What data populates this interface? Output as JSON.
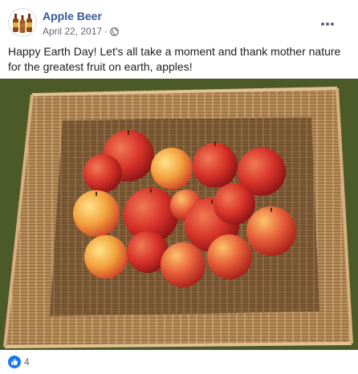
{
  "post": {
    "page_name": "Apple Beer",
    "date": "April 22, 2017",
    "separator": "·",
    "privacy_icon": "globe-icon",
    "text": "Happy Earth Day! Let's all take a moment and thank mother nature for the greatest fruit on earth, apples!",
    "photo": {
      "subject": "apples-in-wicker-basket-photo"
    },
    "reactions": {
      "icon": "thumbs-up-icon",
      "count": "4"
    }
  },
  "colors": {
    "page_name": "#385898",
    "meta_text": "#616770",
    "like_blue": "#1877f2"
  }
}
